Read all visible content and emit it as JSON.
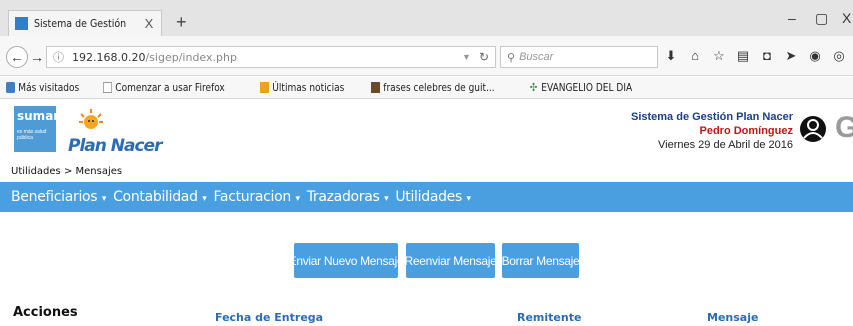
{
  "browser": {
    "tab_title": "Sistema de Gestión Plan N...",
    "tab_close": "X",
    "new_tab": "+",
    "window_controls": {
      "minimize": "–",
      "restore": "▢",
      "close": "X"
    },
    "url_host": "192.168.0.20",
    "url_path": "/sigep/index.php",
    "search_placeholder": "Buscar",
    "bookmarks": [
      {
        "label": "Más visitados",
        "icon": "globe-icon",
        "color": "#3b7fc4"
      },
      {
        "label": "Comenzar a usar Firefox",
        "icon": "page-icon",
        "color": "#ffffff"
      },
      {
        "label": "Últimas noticias",
        "icon": "rss-icon",
        "color": "#f0a020"
      },
      {
        "label": "frases celebres de guit...",
        "icon": "photo-icon",
        "color": "#6b4a2a"
      },
      {
        "label": "EVANGELIO DEL DIA",
        "icon": "cross-icon",
        "color": "#4a8a4a"
      }
    ]
  },
  "header": {
    "logo_box_top": "sumar",
    "logo_box_sub": "es más salud pública",
    "logo_text": "Plan Nacer",
    "system_title": "Sistema de Gestión Plan Nacer",
    "user_name": "Pedro Domínguez",
    "date": "Viernes 29 de Abril de 2016",
    "g_letter": "G"
  },
  "breadcrumb": "Utilidades > Mensajes",
  "menu": [
    {
      "label": "Beneficiarios"
    },
    {
      "label": "Contabilidad"
    },
    {
      "label": "Facturacion"
    },
    {
      "label": "Trazadoras"
    },
    {
      "label": "Utilidades"
    }
  ],
  "actions": {
    "new_message": "Enviar Nuevo Mensaje",
    "resend_message": "Reenviar Mensaje",
    "delete_message": "Borrar Mensaje"
  },
  "table": {
    "actions_label": "Acciones",
    "columns": [
      "Fecha de Entrega",
      "Remitente",
      "Mensaje"
    ]
  },
  "colors": {
    "accent": "#4a9fe1",
    "user_name": "#c0161b",
    "title": "#1c3d8a"
  }
}
